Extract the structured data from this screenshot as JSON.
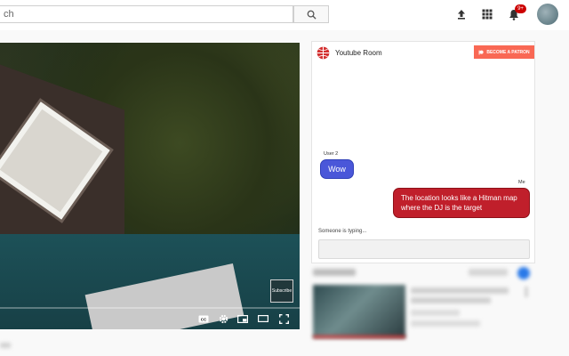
{
  "search": {
    "value": "ch"
  },
  "notifications": {
    "count": "9+"
  },
  "video": {
    "subscribe_label": "Subscribe"
  },
  "chat": {
    "title": "Youtube Room",
    "patron_button": "BECOME A PATRON",
    "messages": [
      {
        "sender": "User 2",
        "text": "Wow"
      },
      {
        "sender": "Me",
        "text": "The location looks like a Hitman map where the DJ is the target"
      }
    ],
    "typing_status": "Someone is typing..."
  },
  "colors": {
    "patron": "#f96854",
    "bubble_other": "#4a57d9",
    "bubble_me": "#c01f2b",
    "notification": "#cc0000"
  }
}
